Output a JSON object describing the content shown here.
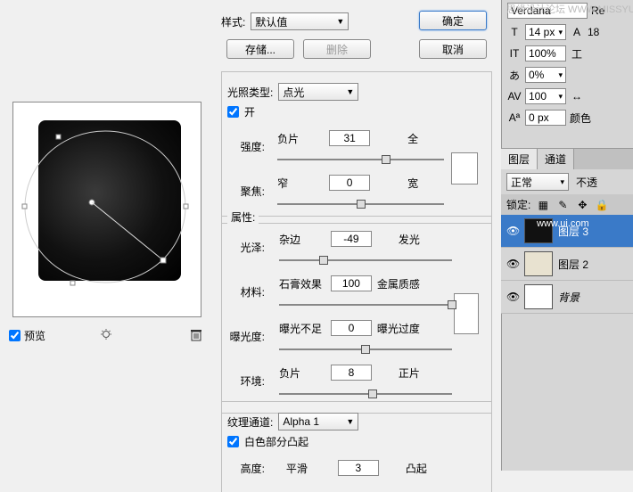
{
  "watermark": "思缘设计论坛  WWW.MISSYUAN.COM",
  "toolbar": {
    "style_label": "样式:",
    "style_value": "默认值",
    "ok": "确定",
    "cancel": "取消",
    "save": "存储...",
    "delete": "删除"
  },
  "preview": {
    "checkbox_label": "预览"
  },
  "group_light": {
    "title": "属性:",
    "light_type_label": "光照类型:",
    "light_type_value": "点光",
    "on_label": "开",
    "intensity_label": "强度:",
    "intensity_left": "负片",
    "intensity_value": "31",
    "intensity_right": "全",
    "focus_label": "聚焦:",
    "focus_left": "窄",
    "focus_value": "0",
    "focus_right": "宽"
  },
  "group_props": {
    "gloss_label": "光泽:",
    "gloss_left": "杂边",
    "gloss_value": "-49",
    "gloss_right": "发光",
    "material_label": "材料:",
    "material_left": "石膏效果",
    "material_value": "100",
    "material_right": "金属质感",
    "exposure_label": "曝光度:",
    "exposure_left": "曝光不足",
    "exposure_value": "0",
    "exposure_right": "曝光过度",
    "ambient_label": "环境:",
    "ambient_left": "负片",
    "ambient_value": "8",
    "ambient_right": "正片"
  },
  "group_texture": {
    "channel_label": "纹理通道:",
    "channel_value": "Alpha 1",
    "white_high_label": "白色部分凸起",
    "height_label": "高度:",
    "height_left": "平滑",
    "height_value": "3",
    "height_right": "凸起"
  },
  "right_top": {
    "font_name": "Verdana",
    "re": "Re",
    "font_size": "14 px",
    "leading": "18",
    "scale_h": "100%",
    "percent_0": "0%",
    "av": "AV",
    "av_value": "100",
    "baseline": "0 px",
    "color_label": "颜色"
  },
  "layers": {
    "tab_layers": "图层",
    "tab_channels": "通道",
    "blend": "正常",
    "opacity_label": "不透",
    "lock_label": "锁定:",
    "items": [
      {
        "label": "图层 3",
        "overlay": "www.ui.com"
      },
      {
        "label": "图层 2"
      },
      {
        "label": "背景"
      }
    ]
  }
}
